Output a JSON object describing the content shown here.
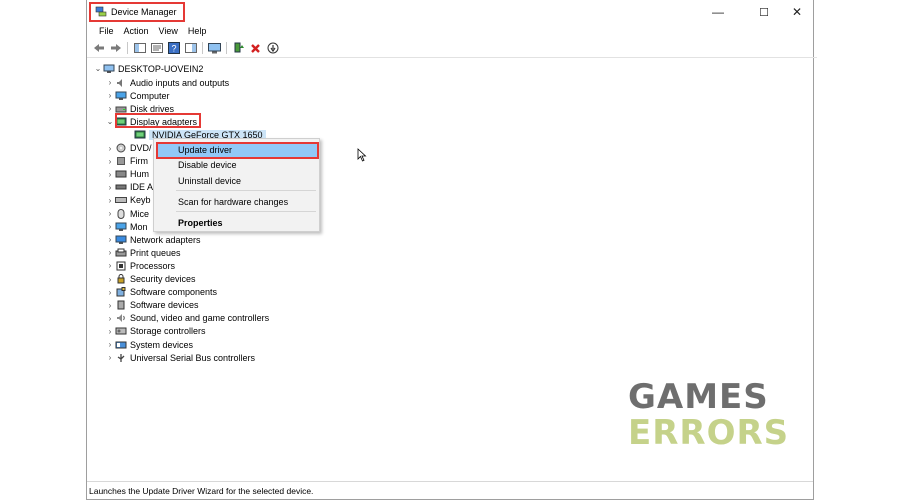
{
  "window": {
    "title": "Device Manager",
    "controls": {
      "minimize": "—",
      "maximize": "☐",
      "close": "✕"
    }
  },
  "menu": [
    "File",
    "Action",
    "View",
    "Help"
  ],
  "toolbar": {
    "icons": [
      "back-icon",
      "forward-icon",
      "show-hide-console-tree-icon",
      "properties-icon",
      "help-icon",
      "action-pane-icon",
      "scan-hardware-icon",
      "update-driver-icon",
      "uninstall-icon",
      "disable-icon"
    ]
  },
  "tree": {
    "root": "DESKTOP-UOVEIN2",
    "items": [
      {
        "label": "Audio inputs and outputs",
        "icon": "speaker-icon"
      },
      {
        "label": "Computer",
        "icon": "monitor-icon"
      },
      {
        "label": "Disk drives",
        "icon": "disk-icon"
      },
      {
        "label": "Display adapters",
        "icon": "display-adapter-icon",
        "expanded": true
      },
      {
        "label": "NVIDIA GeForce GTX 1650",
        "icon": "display-adapter-icon",
        "child": true,
        "selected": true
      },
      {
        "label": "DVD/",
        "icon": "dvd-icon"
      },
      {
        "label": "Firm",
        "icon": "firmware-icon"
      },
      {
        "label": "Hum",
        "icon": "hid-icon"
      },
      {
        "label": "IDE A",
        "icon": "ide-icon"
      },
      {
        "label": "Keyb",
        "icon": "keyboard-icon"
      },
      {
        "label": "Mice",
        "icon": "mouse-icon"
      },
      {
        "label": "Mon",
        "icon": "monitor-icon"
      },
      {
        "label": "Network adapters",
        "icon": "network-icon"
      },
      {
        "label": "Print queues",
        "icon": "printer-icon"
      },
      {
        "label": "Processors",
        "icon": "processor-icon"
      },
      {
        "label": "Security devices",
        "icon": "security-icon"
      },
      {
        "label": "Software components",
        "icon": "software-component-icon"
      },
      {
        "label": "Software devices",
        "icon": "software-device-icon"
      },
      {
        "label": "Sound, video and game controllers",
        "icon": "sound-icon"
      },
      {
        "label": "Storage controllers",
        "icon": "storage-icon"
      },
      {
        "label": "System devices",
        "icon": "system-icon"
      },
      {
        "label": "Universal Serial Bus controllers",
        "icon": "usb-icon"
      }
    ]
  },
  "context_menu": {
    "items": [
      "Update driver",
      "Disable device",
      "Uninstall device",
      "Scan for hardware changes",
      "Properties"
    ]
  },
  "status": "Launches the Update Driver Wizard for the selected device.",
  "watermark": {
    "line1": "GAMES",
    "line2": "ERRORS"
  },
  "colors": {
    "highlight_box": "#e53935",
    "menu_hover": "#91c9f7",
    "selection": "#cce4f7"
  }
}
